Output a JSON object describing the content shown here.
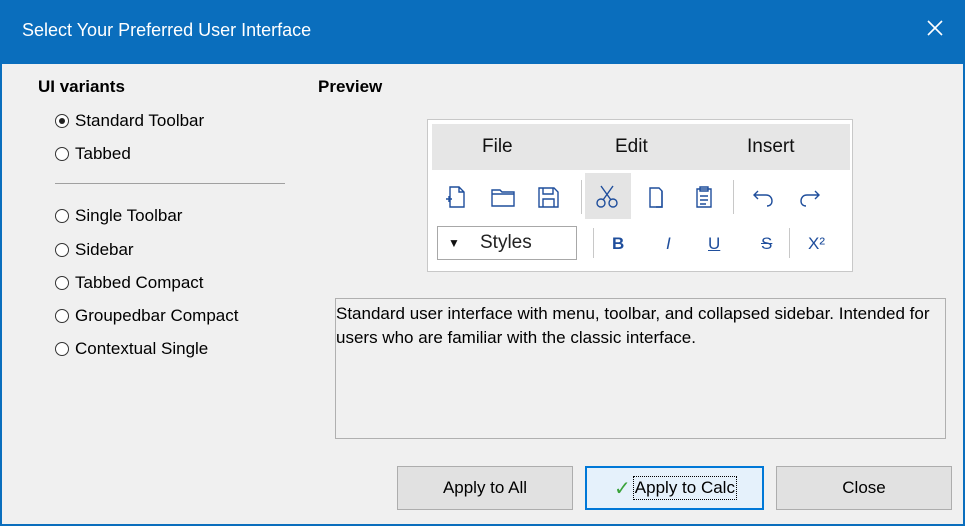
{
  "window": {
    "title": "Select Your Preferred User Interface",
    "close_icon": "close-icon"
  },
  "variants": {
    "heading": "UI variants",
    "group1": [
      {
        "label": "Standard Toolbar",
        "selected": true
      },
      {
        "label": "Tabbed",
        "selected": false
      }
    ],
    "group2": [
      {
        "label": "Single Toolbar",
        "selected": false
      },
      {
        "label": "Sidebar",
        "selected": false
      },
      {
        "label": "Tabbed Compact",
        "selected": false
      },
      {
        "label": "Groupedbar Compact",
        "selected": false
      },
      {
        "label": "Contextual Single",
        "selected": false
      }
    ]
  },
  "preview": {
    "heading": "Preview",
    "menu": [
      "File",
      "Edit",
      "Insert"
    ],
    "toolbar_icons": [
      "new-document-icon",
      "open-folder-icon",
      "save-icon",
      "cut-icon",
      "copy-icon",
      "paste-icon",
      "undo-icon",
      "redo-icon"
    ],
    "styles_label": "Styles",
    "format_buttons": [
      "B",
      "I",
      "U",
      "S",
      "X²"
    ]
  },
  "description": "Standard user interface with menu, toolbar, and collapsed sidebar. Intended for users who are familiar with the classic interface.",
  "buttons": {
    "apply_all": "Apply to All",
    "apply_calc": "Apply to Calc",
    "close": "Close"
  },
  "colors": {
    "titlebar": "#0a6ebd",
    "accent": "#0078d7",
    "check": "#3aa33a",
    "format_text": "#1f4e9c"
  }
}
